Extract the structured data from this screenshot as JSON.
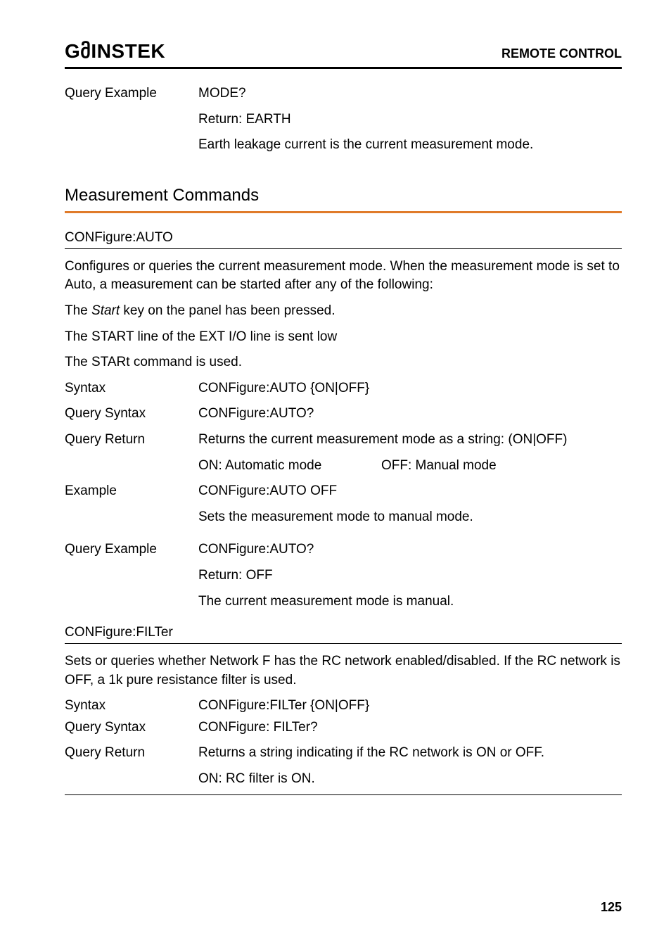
{
  "header": {
    "brand": "GმINSTEK",
    "title": "REMOTE CONTROL"
  },
  "queryExample1": {
    "label": "Query Example",
    "value1": "MODE?",
    "value2": "Return: EARTH",
    "value3": "Earth leakage current is the current measurement mode."
  },
  "sectionTitle": "Measurement Commands",
  "confAuto": {
    "heading": "CONFigure:AUTO",
    "desc": "Configures or queries the current measurement mode. When the measurement mode is set to Auto, a measurement can be started after any of the following:",
    "line1a": "The ",
    "line1b": "Start",
    "line1c": " key on the panel has been pressed.",
    "line2": "The START line of the EXT I/O line is sent low",
    "line3": "The STARt command is used.",
    "syntaxLabel": "Syntax",
    "syntaxValue": "CONFigure:AUTO {ON|OFF}",
    "querySyntaxLabel": "Query Syntax",
    "querySyntaxValue": "CONFigure:AUTO?",
    "queryReturnLabel": "Query Return",
    "queryReturnValue": "Returns the current measurement mode as a string: (ON|OFF)",
    "onLabel": "ON: Automatic mode",
    "offLabel": "OFF: Manual mode",
    "exampleLabel": "Example",
    "exampleValue1": "CONFigure:AUTO OFF",
    "exampleValue2": "Sets the measurement mode to manual mode.",
    "queryExampleLabel": "Query Example",
    "queryExampleValue1": "CONFigure:AUTO?",
    "queryExampleValue2": "Return: OFF",
    "queryExampleValue3": "The current measurement mode is manual."
  },
  "confFilter": {
    "heading": "CONFigure:FILTer",
    "desc": "Sets or queries whether Network F has the RC network enabled/disabled. If the RC network is OFF, a 1k pure resistance filter is used.",
    "syntaxLabel": "Syntax",
    "syntaxValue": "CONFigure:FILTer {ON|OFF}",
    "querySyntaxLabel": "Query Syntax",
    "querySyntaxValue": "CONFigure: FILTer?",
    "queryReturnLabel": "Query Return",
    "queryReturnValue": "Returns a string indicating if the RC network is ON or OFF.",
    "onValue": "ON: RC filter is ON."
  },
  "pageNumber": "125"
}
